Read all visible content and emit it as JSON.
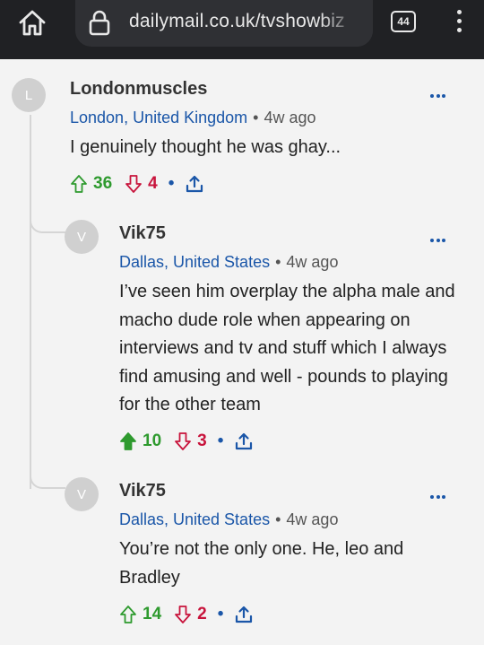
{
  "browser": {
    "url": "dailymail.co.uk/tvshowbiz",
    "tab_count": "44"
  },
  "comments": [
    {
      "avatar_letter": "L",
      "username": "Londonmuscles",
      "location": "London, United Kingdom",
      "time": "4w ago",
      "text": "I genuinely thought he was ghay...",
      "upvotes": "36",
      "downvotes": "4",
      "upvoted": false
    },
    {
      "avatar_letter": "V",
      "username": "Vik75",
      "location": "Dallas, United States",
      "time": "4w ago",
      "text": "I’ve seen him overplay the alpha male and macho dude role when appearing on interviews and tv and stuff which I always find amusing and well - pounds to playing for the other team",
      "upvotes": "10",
      "downvotes": "3",
      "upvoted": true
    },
    {
      "avatar_letter": "V",
      "username": "Vik75",
      "location": "Dallas, United States",
      "time": "4w ago",
      "text": "You’re not the only one. He, leo and Bradley",
      "upvotes": "14",
      "downvotes": "2",
      "upvoted": false
    }
  ],
  "colors": {
    "location": "#1a56a8",
    "upvote": "#2e9a2e",
    "downvote": "#c8143c",
    "share": "#1a56a8"
  },
  "icons": {
    "home": "home-icon",
    "lock": "lock-icon",
    "tabs": "tabs-icon",
    "menu": "kebab-menu-icon",
    "more": "more-options-icon",
    "upvote": "upvote-arrow-icon",
    "downvote": "downvote-arrow-icon",
    "share": "share-icon"
  }
}
